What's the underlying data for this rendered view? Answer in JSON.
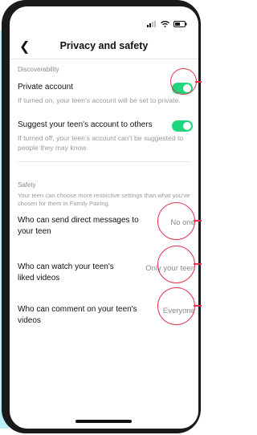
{
  "header": {
    "back_glyph": "❮",
    "title": "Privacy and safety"
  },
  "discoverability": {
    "section_title": "Discoverability",
    "private_account": {
      "label": "Private account",
      "description": "If turned on, your teen's account will be set to private.",
      "enabled": true
    },
    "suggest_account": {
      "label": "Suggest your teen's account to others",
      "description": "If turned off, your teen's account can't be suggested to people they may know.",
      "enabled": true
    }
  },
  "safety": {
    "section_title": "Safety",
    "description": "Your teen can choose more restrictive settings than what you've chosen for them in Family Pairing.",
    "direct_messages": {
      "label": "Who can send direct messages to your teen",
      "value": "No one"
    },
    "liked_videos": {
      "label": "Who can watch your teen's liked videos",
      "value": "Only your teen"
    },
    "comments": {
      "label": "Who can comment on your teen's videos",
      "value": "Everyone"
    }
  },
  "colors": {
    "toggle_on": "#20d67a",
    "highlight_ring": "#e0324b",
    "side_panel": "#bdeef5"
  },
  "icons": [
    "signal-icon",
    "wifi-icon",
    "battery-icon",
    "back-icon"
  ]
}
